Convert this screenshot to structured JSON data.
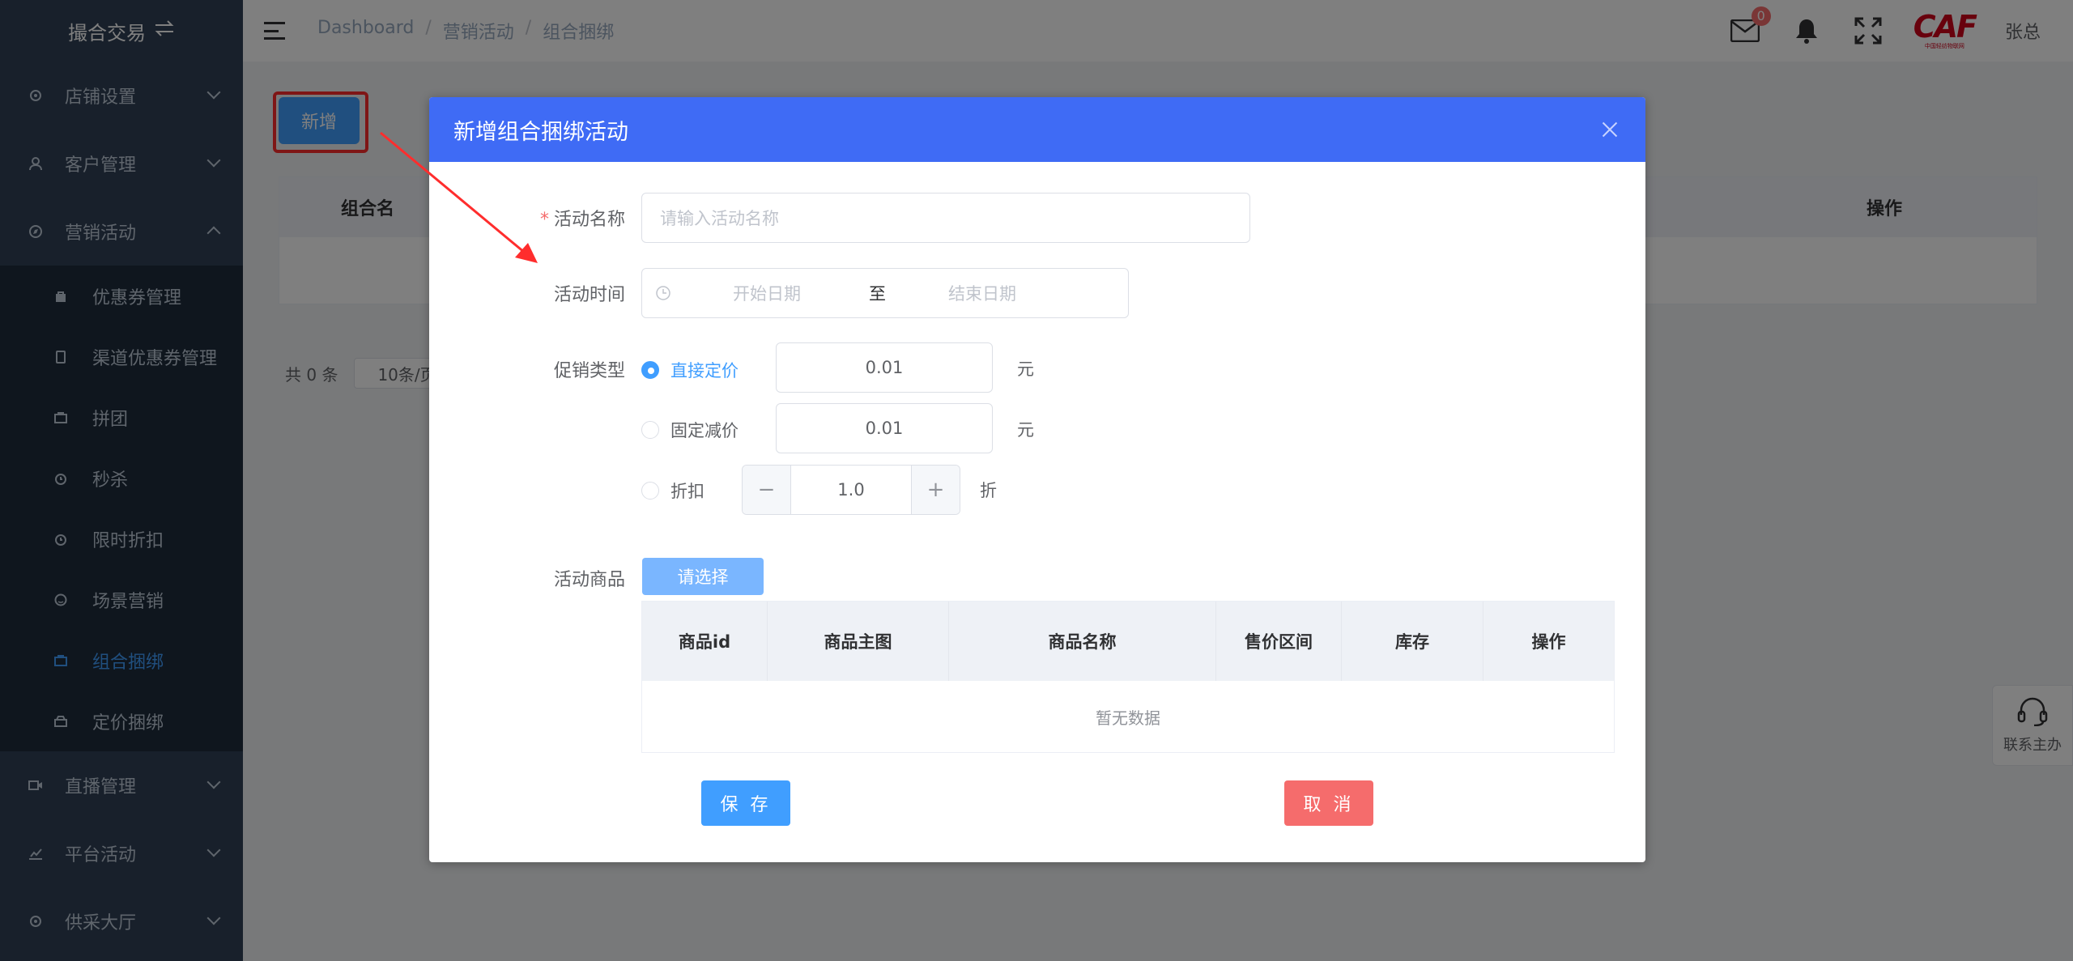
{
  "sidebar": {
    "brand": "撮合交易",
    "groups": [
      {
        "label": "店铺设置",
        "icon": "gear-icon"
      },
      {
        "label": "客户管理",
        "icon": "user-icon"
      },
      {
        "label": "营销活动",
        "icon": "compass-icon"
      }
    ],
    "sub_items": [
      {
        "label": "优惠券管理"
      },
      {
        "label": "渠道优惠券管理"
      },
      {
        "label": "拼团"
      },
      {
        "label": "秒杀"
      },
      {
        "label": "限时折扣"
      },
      {
        "label": "场景营销"
      },
      {
        "label": "组合捆绑"
      },
      {
        "label": "定价捆绑"
      }
    ],
    "bottom_groups": [
      {
        "label": "直播管理"
      },
      {
        "label": "平台活动"
      },
      {
        "label": "供采大厅"
      }
    ]
  },
  "header": {
    "breadcrumb": [
      "Dashboard",
      "营销活动",
      "组合捆绑"
    ],
    "mail_badge": "0",
    "logo": "CAF",
    "logo_sub": "中国轻纺物联网",
    "username": "张总"
  },
  "main": {
    "add_button": "新增",
    "table_headers": [
      "组合名",
      "操作"
    ],
    "pager": {
      "total": "共 0 条",
      "page_size": "10条/页"
    }
  },
  "contact": {
    "label": "联系主办"
  },
  "dialog": {
    "title": "新增组合捆绑活动",
    "name_label": "活动名称",
    "name_placeholder": "请输入活动名称",
    "time_label": "活动时间",
    "start_placeholder": "开始日期",
    "range_sep": "至",
    "end_placeholder": "结束日期",
    "promo_label": "促销类型",
    "options": [
      {
        "label": "直接定价",
        "value": "0.01",
        "unit": "元",
        "checked": true
      },
      {
        "label": "固定减价",
        "value": "0.01",
        "unit": "元",
        "checked": false
      },
      {
        "label": "折扣",
        "value": "1.0",
        "unit": "折",
        "checked": false
      }
    ],
    "goods_label": "活动商品",
    "select_button": "请选择",
    "goods_headers": [
      "商品id",
      "商品主图",
      "商品名称",
      "售价区间",
      "库存",
      "操作"
    ],
    "empty_text": "暂无数据",
    "save_button": "保 存",
    "cancel_button": "取 消"
  },
  "colors": {
    "primary": "#409eff",
    "dialog_header": "#3f6bf5",
    "danger": "#f56c6c",
    "sidebar": "#304156",
    "highlight": "#ff2d2d"
  }
}
